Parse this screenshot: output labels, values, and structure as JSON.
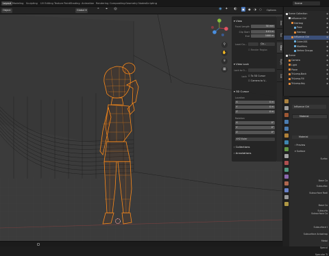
{
  "topbar": {
    "tabs": [
      "Layout",
      "Modeling",
      "Sculpting",
      "UV Editing",
      "Texture Paint",
      "Shading",
      "Animation",
      "Rendering",
      "Compositing",
      "Geometry Nodes",
      "Scripting"
    ],
    "scene": "Scene"
  },
  "header": {
    "mode": "Object",
    "transform": "Global",
    "options": "Options"
  },
  "npanel": {
    "tabs": [
      "Item",
      "Tool",
      "View",
      "Rigify",
      "Edit"
    ],
    "view_title": "View",
    "focal_label": "Focal Length",
    "focal_value": "50 mm",
    "clip_start_label": "Clip Start",
    "clip_start_value": "0.01 m",
    "clip_end_label": "End",
    "clip_end_value": "1000 m",
    "local_camera_label": "Local Ca...",
    "local_camera_value": "Ca...",
    "render_region": "Render Region",
    "viewlock_title": "View Lock",
    "lock_object_label": "Lock to O...",
    "lock_label": "Lock",
    "to_3d_cursor": "To 3D Cursor",
    "camera_to_view": "Camera to V...",
    "cursor_title": "3D Cursor",
    "location_label": "Location",
    "loc": [
      {
        "axis": "X",
        "value": "0 m"
      },
      {
        "axis": "Y",
        "value": "0 m"
      },
      {
        "axis": "Z",
        "value": "0 m"
      }
    ],
    "rotation_label": "Rotation",
    "rot": [
      {
        "axis": "X",
        "value": "0°"
      },
      {
        "axis": "Y",
        "value": "0°"
      },
      {
        "axis": "Z",
        "value": "0°"
      }
    ],
    "rotation_mode": "XYZ Euler",
    "collections": "Collections",
    "annotations": "Annotations"
  },
  "outliner": {
    "rows": [
      {
        "label": "Scene Collection",
        "indent": 0,
        "color": "#dddddd",
        "sel": false
      },
      {
        "label": "Influence Girl",
        "indent": 1,
        "color": "#dddddd",
        "sel": false
      },
      {
        "label": "Hairbag",
        "indent": 2,
        "color": "#e88c3a",
        "sel": false
      },
      {
        "label": "Pose",
        "indent": 3,
        "color": "#6ab0de",
        "sel": false
      },
      {
        "label": "Hairbag",
        "indent": 3,
        "color": "#e88c3a",
        "sel": false
      },
      {
        "label": "Influence Girl",
        "indent": 2,
        "color": "#e88c3a",
        "sel": true
      },
      {
        "label": "Cube.001",
        "indent": 3,
        "color": "#6ab0de",
        "sel": false
      },
      {
        "label": "Modifiers",
        "indent": 3,
        "color": "#6ab0de",
        "sel": false
      },
      {
        "label": "Vertex Groups",
        "indent": 3,
        "color": "#6ab0de",
        "sel": false
      },
      {
        "label": "Scene",
        "indent": 0,
        "color": "#dddddd",
        "sel": false
      },
      {
        "label": "Camera",
        "indent": 1,
        "color": "#e88c3a",
        "sel": false
      },
      {
        "label": "Light",
        "indent": 1,
        "color": "#e88c3a",
        "sel": false
      },
      {
        "label": "Plane",
        "indent": 1,
        "color": "#e88c3a",
        "sel": false
      },
      {
        "label": "TriLamp-Back",
        "indent": 1,
        "color": "#e88c3a",
        "sel": false
      },
      {
        "label": "TriLamp-Fill",
        "indent": 1,
        "color": "#e88c3a",
        "sel": false
      },
      {
        "label": "TriLamp-Key",
        "indent": 1,
        "color": "#e88c3a",
        "sel": false
      }
    ]
  },
  "props": {
    "object_name": "Influence Girl",
    "material": "Material",
    "material2": "Material",
    "preview": "Preview",
    "surface": "Surface",
    "rows": [
      "Surfac",
      "Base Co",
      "Subsurfac",
      "Subsurface Radi",
      "Base Co",
      "Subsurfa",
      "Subsurface Co",
      "Subsurface I",
      "Subsurface Anisotrop",
      "Metal",
      "Specul",
      "Specular Ti"
    ]
  },
  "colors": {
    "accent": "#4772b3",
    "orange": "#ff8c1a"
  }
}
